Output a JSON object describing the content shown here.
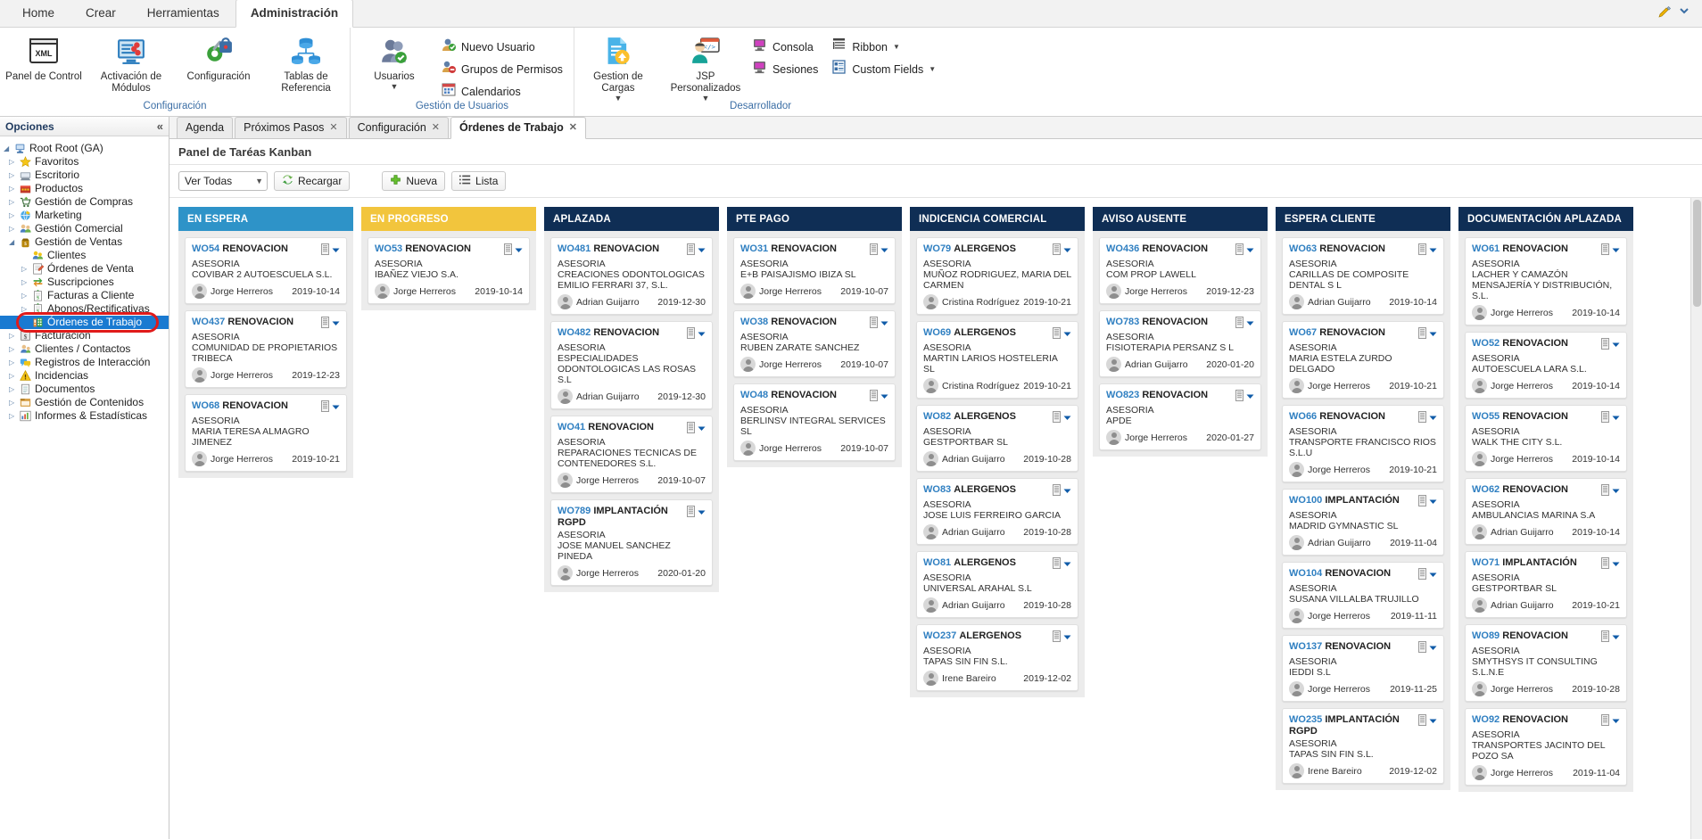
{
  "ribbon": {
    "tabs": [
      {
        "label": "Home",
        "active": false
      },
      {
        "label": "Crear",
        "active": false
      },
      {
        "label": "Herramientas",
        "active": false
      },
      {
        "label": "Administración",
        "active": true
      }
    ],
    "groups": [
      {
        "label": "Configuración",
        "big_items": [
          {
            "label": "Panel de Control",
            "icon": "xml-window-icon"
          },
          {
            "label": "Activación de Módulos",
            "icon": "monitor-settings-icon"
          },
          {
            "label": "Configuración",
            "icon": "gear-lock-icon"
          },
          {
            "label": "Tablas de Referencia",
            "icon": "database-tree-icon"
          }
        ],
        "small_items": []
      },
      {
        "label": "Gestión de Usuarios",
        "big_items": [
          {
            "label": "Usuarios",
            "icon": "users-icon",
            "caret": true
          }
        ],
        "small_items": [
          {
            "label": "Nuevo Usuario",
            "icon": "user-add-icon"
          },
          {
            "label": "Grupos de Permisos",
            "icon": "user-group-deny-icon"
          },
          {
            "label": "Calendarios",
            "icon": "calendar-icon"
          }
        ]
      },
      {
        "label": "Desarrollador",
        "big_items": [
          {
            "label": "Gestion de Cargas",
            "icon": "file-upload-icon",
            "caret": true
          },
          {
            "label": "JSP Personalizados",
            "icon": "developer-code-icon",
            "caret": true
          }
        ],
        "small_items": [
          {
            "label": "Consola",
            "icon": "console-icon"
          },
          {
            "label": "Sesiones",
            "icon": "sessions-icon"
          },
          {
            "label": "Ribbon",
            "icon": "ribbon-list-icon",
            "caret": true
          },
          {
            "label": "Custom Fields",
            "icon": "custom-fields-icon",
            "caret": true
          }
        ]
      }
    ]
  },
  "sidebar": {
    "title": "Opciones",
    "collapse_label": "«",
    "tree": [
      {
        "label": "Root Root (GA)",
        "level": 0,
        "arrow": "open",
        "icon": "computer-icon"
      },
      {
        "label": "Favoritos",
        "level": 1,
        "arrow": "closed",
        "icon": "star-icon"
      },
      {
        "label": "Escritorio",
        "level": 1,
        "arrow": "closed",
        "icon": "desktop-icon"
      },
      {
        "label": "Productos",
        "level": 1,
        "arrow": "closed",
        "icon": "products-icon"
      },
      {
        "label": "Gestión de Compras",
        "level": 1,
        "arrow": "closed",
        "icon": "purchases-icon"
      },
      {
        "label": "Marketing",
        "level": 1,
        "arrow": "closed",
        "icon": "marketing-icon"
      },
      {
        "label": "Gestión Comercial",
        "level": 1,
        "arrow": "closed",
        "icon": "commercial-icon"
      },
      {
        "label": "Gestión de Ventas",
        "level": 1,
        "arrow": "open",
        "icon": "sales-icon"
      },
      {
        "label": "Clientes",
        "level": 2,
        "arrow": "none",
        "icon": "clients-icon"
      },
      {
        "label": "Órdenes de Venta",
        "level": 2,
        "arrow": "closed",
        "icon": "sales-order-icon"
      },
      {
        "label": "Suscripciones",
        "level": 2,
        "arrow": "closed",
        "icon": "subscriptions-icon"
      },
      {
        "label": "Facturas a Cliente",
        "level": 2,
        "arrow": "closed",
        "icon": "invoice-icon"
      },
      {
        "label": "Abonos/Rectificativas",
        "level": 2,
        "arrow": "closed",
        "icon": "credit-note-icon"
      },
      {
        "label": "Órdenes de Trabajo",
        "level": 2,
        "arrow": "none",
        "icon": "work-order-icon",
        "selected": true
      },
      {
        "label": "Facturacion",
        "level": 1,
        "arrow": "closed",
        "icon": "billing-icon"
      },
      {
        "label": "Clientes / Contactos",
        "level": 1,
        "arrow": "closed",
        "icon": "contacts-icon"
      },
      {
        "label": "Registros de Interacción",
        "level": 1,
        "arrow": "closed",
        "icon": "interaction-icon"
      },
      {
        "label": "Incidencias",
        "level": 1,
        "arrow": "closed",
        "icon": "incidents-icon"
      },
      {
        "label": "Documentos",
        "level": 1,
        "arrow": "closed",
        "icon": "documents-icon"
      },
      {
        "label": "Gestión de Contenidos",
        "level": 1,
        "arrow": "closed",
        "icon": "contents-icon"
      },
      {
        "label": "Informes & Estadísticas",
        "level": 1,
        "arrow": "closed",
        "icon": "reports-icon"
      }
    ]
  },
  "content": {
    "tabs": [
      {
        "label": "Agenda",
        "closable": false,
        "active": false
      },
      {
        "label": "Próximos Pasos",
        "closable": true,
        "active": false
      },
      {
        "label": "Configuración",
        "closable": true,
        "active": false
      },
      {
        "label": "Órdenes de Trabajo",
        "closable": true,
        "active": true
      }
    ],
    "panel_title": "Panel de Taréas Kanban",
    "toolbar": {
      "filter_value": "Ver Todas",
      "reload_label": "Recargar",
      "new_label": "Nueva",
      "list_label": "Lista"
    }
  },
  "kanban": {
    "columns": [
      {
        "title": "EN ESPERA",
        "color": "#2e93c8",
        "cards": [
          {
            "code": "WO54",
            "type": "RENOVACION",
            "category": "ASESORIA",
            "client": "COVIBAR 2 AUTOESCUELA S.L.",
            "user": "Jorge Herreros",
            "date": "2019-10-14"
          },
          {
            "code": "WO437",
            "type": "RENOVACION",
            "category": "ASESORIA",
            "client": "COMUNIDAD DE PROPIETARIOS TRIBECA",
            "user": "Jorge Herreros",
            "date": "2019-12-23"
          },
          {
            "code": "WO68",
            "type": "RENOVACION",
            "category": "ASESORIA",
            "client": "MARIA TERESA ALMAGRO JIMENEZ",
            "user": "Jorge Herreros",
            "date": "2019-10-21"
          }
        ]
      },
      {
        "title": "EN PROGRESO",
        "color": "#f2c53d",
        "cards": [
          {
            "code": "WO53",
            "type": "RENOVACION",
            "category": "ASESORIA",
            "client": "IBAÑEZ VIEJO S.A.",
            "user": "Jorge Herreros",
            "date": "2019-10-14"
          }
        ]
      },
      {
        "title": "APLAZADA",
        "color": "#0f2e55",
        "cards": [
          {
            "code": "WO481",
            "type": "RENOVACION",
            "category": "ASESORIA",
            "client": "CREACIONES ODONTOLOGICAS EMILIO FERRARI 37, S.L.",
            "user": "Adrian Guijarro",
            "date": "2019-12-30"
          },
          {
            "code": "WO482",
            "type": "RENOVACION",
            "category": "ASESORIA",
            "client": "ESPECIALIDADES ODONTOLOGICAS LAS ROSAS S.L",
            "user": "Adrian Guijarro",
            "date": "2019-12-30"
          },
          {
            "code": "WO41",
            "type": "RENOVACION",
            "category": "ASESORIA",
            "client": "REPARACIONES TECNICAS DE CONTENEDORES S.L.",
            "user": "Jorge Herreros",
            "date": "2019-10-07"
          },
          {
            "code": "WO789",
            "type": "IMPLANTACIÓN RGPD",
            "category": "ASESORIA",
            "client": "JOSE MANUEL SANCHEZ PINEDA",
            "user": "Jorge Herreros",
            "date": "2020-01-20"
          }
        ]
      },
      {
        "title": "PTE PAGO",
        "color": "#0f2e55",
        "cards": [
          {
            "code": "WO31",
            "type": "RENOVACION",
            "category": "ASESORIA",
            "client": "E+B PAISAJISMO IBIZA SL",
            "user": "Jorge Herreros",
            "date": "2019-10-07"
          },
          {
            "code": "WO38",
            "type": "RENOVACION",
            "category": "ASESORIA",
            "client": "RUBEN ZARATE SANCHEZ",
            "user": "Jorge Herreros",
            "date": "2019-10-07"
          },
          {
            "code": "WO48",
            "type": "RENOVACION",
            "category": "ASESORIA",
            "client": "BERLINSV INTEGRAL SERVICES SL",
            "user": "Jorge Herreros",
            "date": "2019-10-07"
          }
        ]
      },
      {
        "title": "INDICENCIA COMERCIAL",
        "color": "#0f2e55",
        "cards": [
          {
            "code": "WO79",
            "type": "ALERGENOS",
            "category": "ASESORIA",
            "client": "MUÑOZ RODRIGUEZ, MARIA DEL CARMEN",
            "user": "Cristina Rodríguez",
            "date": "2019-10-21"
          },
          {
            "code": "WO69",
            "type": "ALERGENOS",
            "category": "ASESORIA",
            "client": "MARTIN LARIOS HOSTELERIA SL",
            "user": "Cristina Rodríguez",
            "date": "2019-10-21"
          },
          {
            "code": "WO82",
            "type": "ALERGENOS",
            "category": "ASESORIA",
            "client": "GESTPORTBAR SL",
            "user": "Adrian Guijarro",
            "date": "2019-10-28"
          },
          {
            "code": "WO83",
            "type": "ALERGENOS",
            "category": "ASESORIA",
            "client": "JOSE LUIS FERREIRO GARCIA",
            "user": "Adrian Guijarro",
            "date": "2019-10-28"
          },
          {
            "code": "WO81",
            "type": "ALERGENOS",
            "category": "ASESORIA",
            "client": "UNIVERSAL ARAHAL S.L",
            "user": "Adrian Guijarro",
            "date": "2019-10-28"
          },
          {
            "code": "WO237",
            "type": "ALERGENOS",
            "category": "ASESORIA",
            "client": "TAPAS SIN FIN S.L.",
            "user": "Irene Bareiro",
            "date": "2019-12-02"
          }
        ]
      },
      {
        "title": "AVISO AUSENTE",
        "color": "#0f2e55",
        "cards": [
          {
            "code": "WO436",
            "type": "RENOVACION",
            "category": "ASESORIA",
            "client": "COM PROP LAWELL",
            "user": "Jorge Herreros",
            "date": "2019-12-23"
          },
          {
            "code": "WO783",
            "type": "RENOVACION",
            "category": "ASESORIA",
            "client": "FISIOTERAPIA PERSANZ S L",
            "user": "Adrian Guijarro",
            "date": "2020-01-20"
          },
          {
            "code": "WO823",
            "type": "RENOVACION",
            "category": "ASESORIA",
            "client": "APDE",
            "user": "Jorge Herreros",
            "date": "2020-01-27"
          }
        ]
      },
      {
        "title": "ESPERA CLIENTE",
        "color": "#0f2e55",
        "cards": [
          {
            "code": "WO63",
            "type": "RENOVACION",
            "category": "ASESORIA",
            "client": "CARILLAS DE COMPOSITE DENTAL S L",
            "user": "Adrian Guijarro",
            "date": "2019-10-14"
          },
          {
            "code": "WO67",
            "type": "RENOVACION",
            "category": "ASESORIA",
            "client": "MARIA ESTELA ZURDO DELGADO",
            "user": "Jorge Herreros",
            "date": "2019-10-21"
          },
          {
            "code": "WO66",
            "type": "RENOVACION",
            "category": "ASESORIA",
            "client": "TRANSPORTE FRANCISCO RIOS S.L.U",
            "user": "Jorge Herreros",
            "date": "2019-10-21"
          },
          {
            "code": "WO100",
            "type": "IMPLANTACIÓN",
            "category": "ASESORIA",
            "client": "MADRID GYMNASTIC SL",
            "user": "Adrian Guijarro",
            "date": "2019-11-04"
          },
          {
            "code": "WO104",
            "type": "RENOVACION",
            "category": "ASESORIA",
            "client": "SUSANA VILLALBA TRUJILLO",
            "user": "Jorge Herreros",
            "date": "2019-11-11"
          },
          {
            "code": "WO137",
            "type": "RENOVACION",
            "category": "ASESORIA",
            "client": "IEDDI S.L",
            "user": "Jorge Herreros",
            "date": "2019-11-25"
          },
          {
            "code": "WO235",
            "type": "IMPLANTACIÓN RGPD",
            "category": "ASESORIA",
            "client": "TAPAS SIN FIN S.L.",
            "user": "Irene Bareiro",
            "date": "2019-12-02"
          }
        ]
      },
      {
        "title": "DOCUMENTACIÓN APLAZADA",
        "color": "#0f2e55",
        "cards": [
          {
            "code": "WO61",
            "type": "RENOVACION",
            "category": "ASESORIA",
            "client": "LACHER Y CAMAZÓN MENSAJERÍA Y DISTRIBUCIÓN, S.L.",
            "user": "Jorge Herreros",
            "date": "2019-10-14"
          },
          {
            "code": "WO52",
            "type": "RENOVACION",
            "category": "ASESORIA",
            "client": "AUTOESCUELA LARA S.L.",
            "user": "Jorge Herreros",
            "date": "2019-10-14"
          },
          {
            "code": "WO55",
            "type": "RENOVACION",
            "category": "ASESORIA",
            "client": "WALK THE CITY S.L.",
            "user": "Jorge Herreros",
            "date": "2019-10-14"
          },
          {
            "code": "WO62",
            "type": "RENOVACION",
            "category": "ASESORIA",
            "client": "AMBULANCIAS MARINA S.A",
            "user": "Adrian Guijarro",
            "date": "2019-10-14"
          },
          {
            "code": "WO71",
            "type": "IMPLANTACIÓN",
            "category": "ASESORIA",
            "client": "GESTPORTBAR SL",
            "user": "Adrian Guijarro",
            "date": "2019-10-21"
          },
          {
            "code": "WO89",
            "type": "RENOVACION",
            "category": "ASESORIA",
            "client": "SMYTHSYS IT CONSULTING S.L.N.E",
            "user": "Jorge Herreros",
            "date": "2019-10-28"
          },
          {
            "code": "WO92",
            "type": "RENOVACION",
            "category": "ASESORIA",
            "client": "TRANSPORTES JACINTO DEL POZO SA",
            "user": "Jorge Herreros",
            "date": "2019-11-04"
          }
        ]
      }
    ]
  }
}
